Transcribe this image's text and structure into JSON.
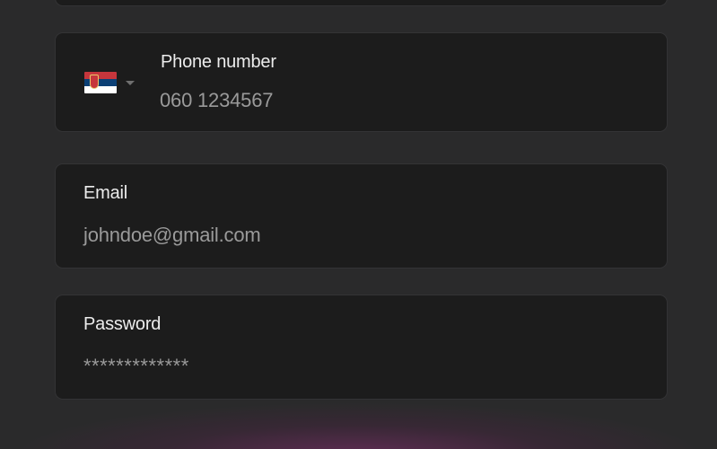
{
  "colors": {
    "page_background": "#2a2a2b",
    "field_background": "#1c1c1c",
    "field_border": "#333335",
    "label_text": "#ececec",
    "value_text": "#9a9a9a",
    "accent_glow": "#6e2d5f"
  },
  "phone": {
    "label": "Phone number",
    "value": "060 1234567",
    "country": {
      "flag_icon": "serbia-flag-icon",
      "flag_colors": [
        "#c6363c",
        "#0c4076",
        "#ffffff"
      ],
      "dropdown_icon": "caret-down-icon"
    }
  },
  "email": {
    "label": "Email",
    "value": "johndoe@gmail.com"
  },
  "password": {
    "label": "Password",
    "value": "*************"
  }
}
